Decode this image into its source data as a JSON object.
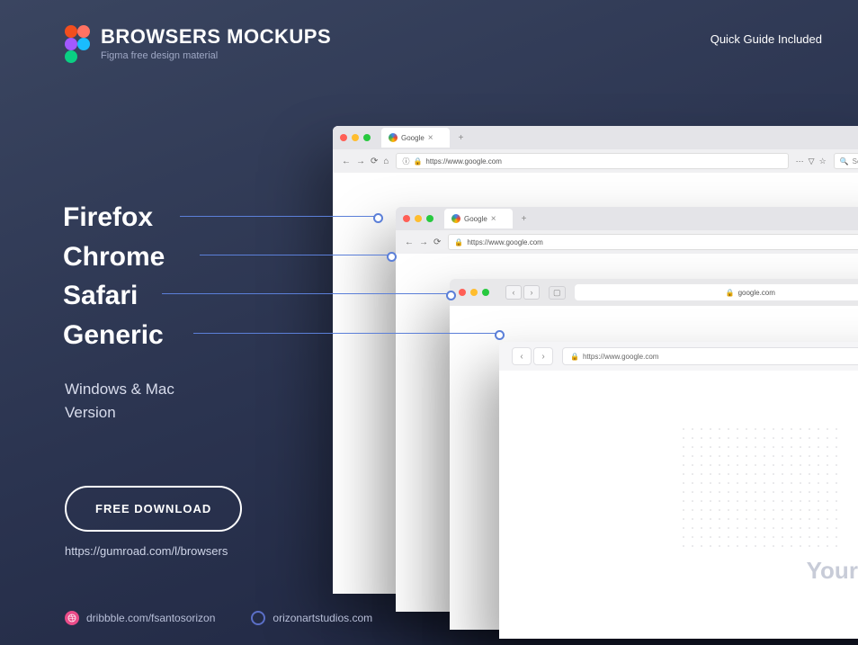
{
  "header": {
    "title": "BROWSERS MOCKUPS",
    "subtitle": "Figma free design material"
  },
  "quick_guide": "Quick Guide Included",
  "browsers": {
    "firefox": "Firefox",
    "chrome": "Chrome",
    "safari": "Safari",
    "generic": "Generic"
  },
  "version_text_1": "Windows & Mac",
  "version_text_2": "Version",
  "download_label": "FREE DOWNLOAD",
  "download_url": "https://gumroad.com/l/browsers",
  "footer": {
    "dribbble": "dribbble.com/fsantosorizon",
    "orizon": "orizonartstudios.com"
  },
  "mockups": {
    "firefox": {
      "tab_title": "Google",
      "url": "https://www.google.com",
      "search_placeholder": "Search"
    },
    "chrome": {
      "tab_title": "Google",
      "url": "https://www.google.com"
    },
    "safari": {
      "url": "google.com"
    },
    "generic": {
      "url": "https://www.google.com"
    }
  },
  "placeholder_text": "Your screen"
}
